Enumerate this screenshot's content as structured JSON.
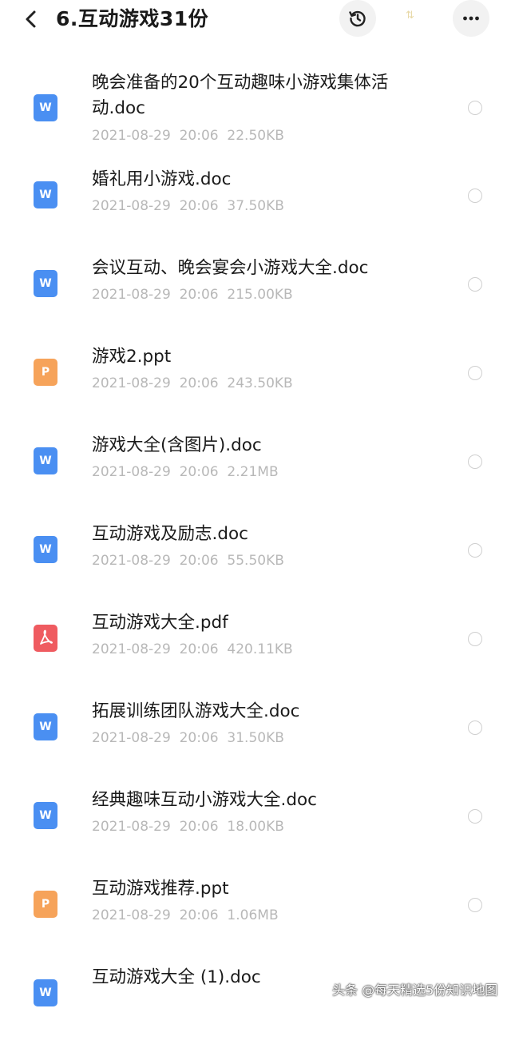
{
  "header": {
    "title": "6.互动游戏31份",
    "sort_label": "⇅"
  },
  "colors": {
    "word": "#4a8ff2",
    "ppt": "#f6a35a",
    "pdf": "#ef5b60"
  },
  "files": [
    {
      "name": "晚会准备的20个互动趣味小游戏集体活动.doc",
      "date": "2021-08-29",
      "time": "20:06",
      "size": "22.50KB",
      "type": "word",
      "icon": "W"
    },
    {
      "name": "婚礼用小游戏.doc",
      "date": "2021-08-29",
      "time": "20:06",
      "size": "37.50KB",
      "type": "word",
      "icon": "W"
    },
    {
      "name": "会议互动、晚会宴会小游戏大全.doc",
      "date": "2021-08-29",
      "time": "20:06",
      "size": "215.00KB",
      "type": "word",
      "icon": "W"
    },
    {
      "name": "游戏2.ppt",
      "date": "2021-08-29",
      "time": "20:06",
      "size": "243.50KB",
      "type": "ppt",
      "icon": "P"
    },
    {
      "name": "游戏大全(含图片).doc",
      "date": "2021-08-29",
      "time": "20:06",
      "size": "2.21MB",
      "type": "word",
      "icon": "W"
    },
    {
      "name": "互动游戏及励志.doc",
      "date": "2021-08-29",
      "time": "20:06",
      "size": "55.50KB",
      "type": "word",
      "icon": "W"
    },
    {
      "name": "互动游戏大全.pdf",
      "date": "2021-08-29",
      "time": "20:06",
      "size": "420.11KB",
      "type": "pdf",
      "icon": "pdf-icon"
    },
    {
      "name": "拓展训练团队游戏大全.doc",
      "date": "2021-08-29",
      "time": "20:06",
      "size": "31.50KB",
      "type": "word",
      "icon": "W"
    },
    {
      "name": "经典趣味互动小游戏大全.doc",
      "date": "2021-08-29",
      "time": "20:06",
      "size": "18.00KB",
      "type": "word",
      "icon": "W"
    },
    {
      "name": "互动游戏推荐.ppt",
      "date": "2021-08-29",
      "time": "20:06",
      "size": "1.06MB",
      "type": "ppt",
      "icon": "P"
    },
    {
      "name": "互动游戏大全 (1).doc",
      "date": "",
      "time": "",
      "size": "",
      "type": "word",
      "icon": "W"
    }
  ],
  "watermark": "头条 @每天精选5份知识地图"
}
